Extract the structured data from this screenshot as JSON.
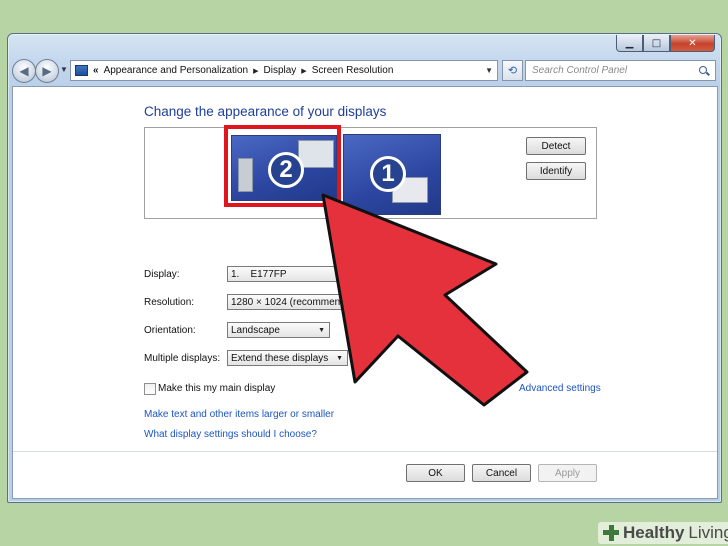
{
  "window": {
    "caption": {
      "minimize": "▁",
      "maximize": "□",
      "close": "✕"
    }
  },
  "navbar": {
    "back_icon": "back-arrow-icon",
    "forward_icon": "forward-arrow-icon",
    "breadcrumb_prefix": "«",
    "breadcrumbs": [
      "Appearance and Personalization",
      "Display",
      "Screen Resolution"
    ],
    "search_placeholder": "Search Control Panel"
  },
  "page": {
    "title": "Change the appearance of your displays",
    "monitors": [
      {
        "number": "2",
        "selected": true
      },
      {
        "number": "1",
        "selected": false
      }
    ],
    "detect_label": "Detect",
    "identify_label": "Identify"
  },
  "form": {
    "display_label": "Display:",
    "display_value": "1.    E177FP",
    "resolution_label": "Resolution:",
    "resolution_value": "1280 × 1024 (recommended)",
    "orientation_label": "Orientation:",
    "orientation_value": "Landscape",
    "multiple_label": "Multiple displays:",
    "multiple_value": "Extend these displays",
    "main_display_label": "Make this my main display",
    "main_display_checked": false,
    "advanced_link": "Advanced settings",
    "link_text_larger": "Make text and other items larger or smaller",
    "link_which_settings": "What display settings should I choose?"
  },
  "buttons": {
    "ok": "OK",
    "cancel": "Cancel",
    "apply": "Apply"
  },
  "overlay": {
    "arrow_color": "#e5313b",
    "highlight_color": "#e0161f"
  },
  "watermark": {
    "brand_bold": "Healthy",
    "brand_light": "Living"
  }
}
